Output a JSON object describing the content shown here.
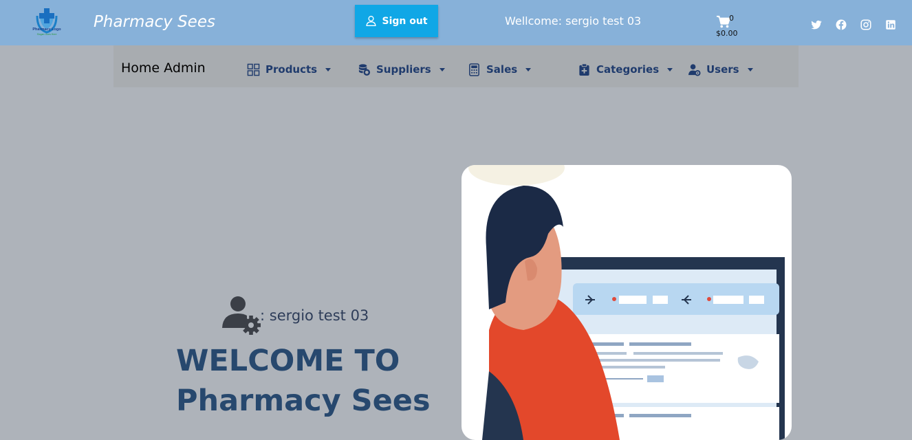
{
  "header": {
    "logo_caption": "Pharmacy Logo",
    "logo_subcaption": "Slogan Goes Here",
    "brand": "Pharmacy Sees",
    "signout_label": "Sign out",
    "welcome_text": "Wellcome: sergio test 03",
    "cart": {
      "count": "0",
      "total": "$0.00"
    },
    "social": [
      "twitter-icon",
      "facebook-icon",
      "instagram-icon",
      "linkedin-icon"
    ],
    "colors": {
      "topbar": "#87b1d9",
      "signout": "#10a7e6",
      "nav_text": "#1f3b6d"
    }
  },
  "nav": {
    "home": "Home Admin",
    "items": [
      {
        "label": "Products",
        "icon": "grid-icon"
      },
      {
        "label": "Suppliers",
        "icon": "coins-icon"
      },
      {
        "label": "Sales",
        "icon": "calculator-icon"
      },
      {
        "label": "Categories",
        "icon": "clipboard-plus-icon"
      },
      {
        "label": "Users",
        "icon": "user-gear-icon"
      }
    ]
  },
  "hero": {
    "admin_label": ": sergio test 03",
    "title_line1": "WELCOME TO",
    "title_line2": "Pharmacy Sees",
    "colors": {
      "title": "#27486e"
    }
  }
}
